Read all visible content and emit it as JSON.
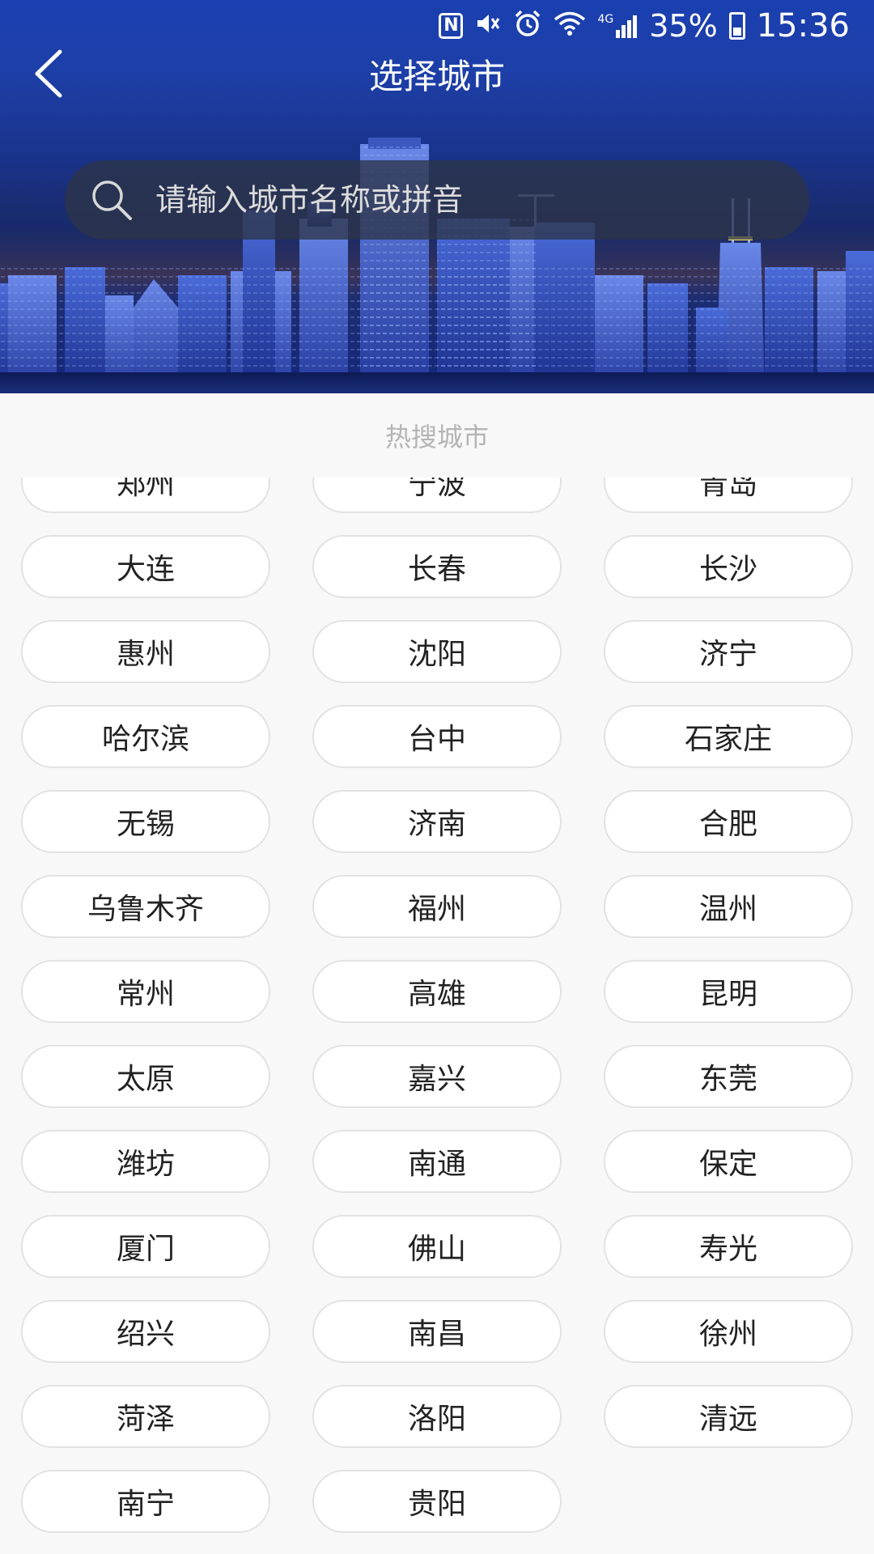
{
  "status_bar": {
    "battery": "35%",
    "time": "15:36",
    "icons": [
      "nfc-icon",
      "vibrate-icon",
      "alarm-icon",
      "wifi-icon",
      "signal-icon",
      "battery-icon"
    ],
    "network_label": "4G"
  },
  "header": {
    "title": "选择城市",
    "back_icon": "chevron-left-icon"
  },
  "search": {
    "placeholder": "请输入城市名称或拼音",
    "icon": "search-icon"
  },
  "hot_cities": {
    "title": "热搜城市",
    "cities": [
      "郑州",
      "宁波",
      "青岛",
      "大连",
      "长春",
      "长沙",
      "惠州",
      "沈阳",
      "济宁",
      "哈尔滨",
      "台中",
      "石家庄",
      "无锡",
      "济南",
      "合肥",
      "乌鲁木齐",
      "福州",
      "温州",
      "常州",
      "高雄",
      "昆明",
      "太原",
      "嘉兴",
      "东莞",
      "潍坊",
      "南通",
      "保定",
      "厦门",
      "佛山",
      "寿光",
      "绍兴",
      "南昌",
      "徐州",
      "菏泽",
      "洛阳",
      "清远",
      "南宁",
      "贵阳"
    ]
  },
  "colors": {
    "header_blue": "#1a3fb0",
    "page_bg": "#f8f8f8",
    "button_border": "#e2e2e2",
    "section_title": "#b4b4b4"
  }
}
